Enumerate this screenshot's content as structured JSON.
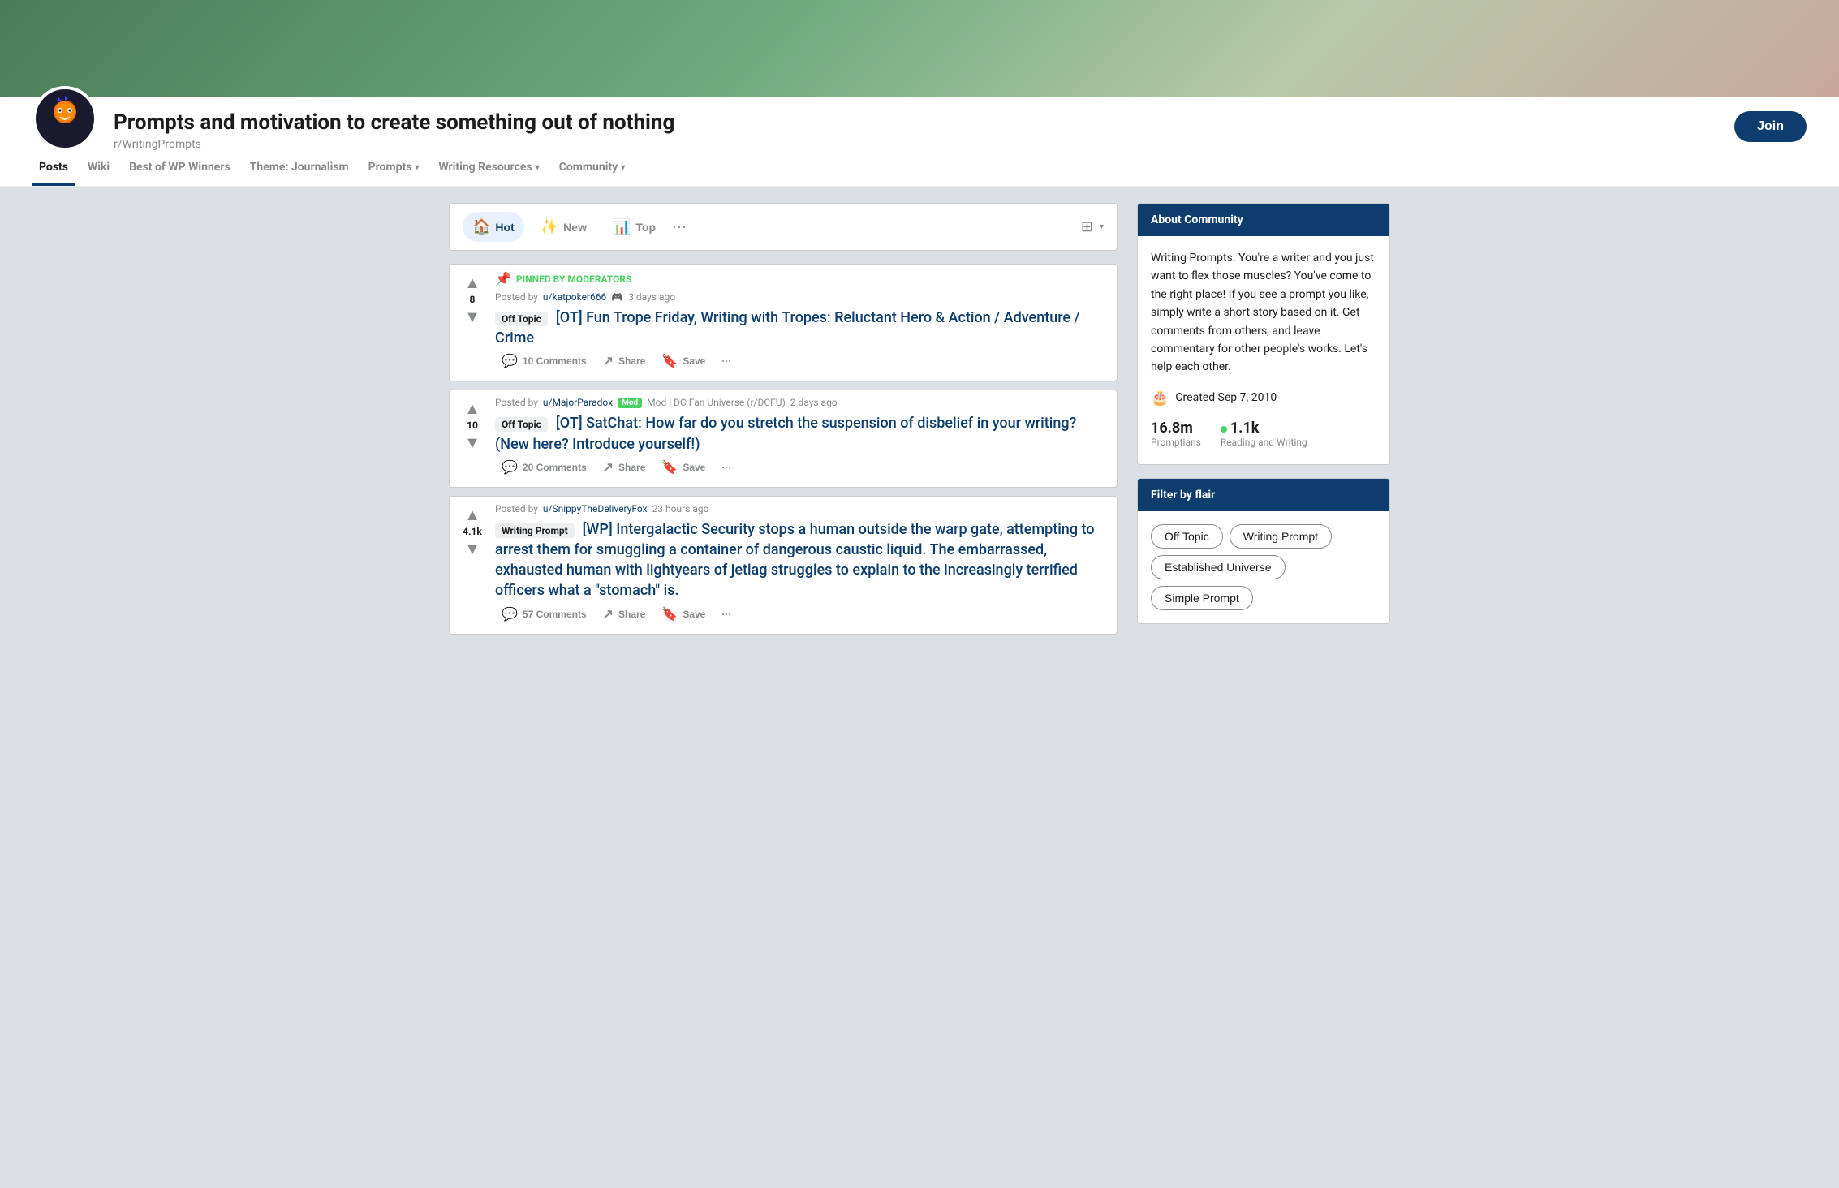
{
  "banner": {
    "alt": "subreddit banner"
  },
  "header": {
    "title": "Prompts and motivation to create something out of nothing",
    "subreddit_name": "r/WritingPrompts",
    "join_label": "Join"
  },
  "nav": {
    "tabs": [
      {
        "id": "posts",
        "label": "Posts",
        "active": true,
        "has_dropdown": false
      },
      {
        "id": "wiki",
        "label": "Wiki",
        "active": false,
        "has_dropdown": false
      },
      {
        "id": "best-of-wp",
        "label": "Best of WP Winners",
        "active": false,
        "has_dropdown": false
      },
      {
        "id": "theme",
        "label": "Theme: Journalism",
        "active": false,
        "has_dropdown": false
      },
      {
        "id": "prompts",
        "label": "Prompts",
        "active": false,
        "has_dropdown": true
      },
      {
        "id": "writing-resources",
        "label": "Writing Resources",
        "active": false,
        "has_dropdown": true
      },
      {
        "id": "community",
        "label": "Community",
        "active": false,
        "has_dropdown": true
      }
    ]
  },
  "sort_bar": {
    "options": [
      {
        "id": "hot",
        "label": "Hot",
        "icon": "🏠",
        "active": true
      },
      {
        "id": "new",
        "label": "New",
        "icon": "✨",
        "active": false
      },
      {
        "id": "top",
        "label": "Top",
        "icon": "📊",
        "active": false
      }
    ],
    "more_label": "···",
    "view_icon": "⊞"
  },
  "posts": [
    {
      "id": "post-1",
      "pinned": true,
      "pinned_label": "PINNED BY MODERATORS",
      "author": "u/katpoker666",
      "author_icon": "🎮",
      "timestamp": "3 days ago",
      "flair": "Off Topic",
      "title": "[OT] Fun Trope Friday, Writing with Tropes: Reluctant Hero & Action / Adventure / Crime",
      "vote_count": "8",
      "comments_count": "10 Comments",
      "share_label": "Share",
      "save_label": "Save",
      "more_label": "···"
    },
    {
      "id": "post-2",
      "pinned": false,
      "author": "u/MajorParadox",
      "author_mod": true,
      "mod_label": "Mod | DC Fan Universe (r/DCFU)",
      "timestamp": "2 days ago",
      "flair": "Off Topic",
      "title": "[OT] SatChat: How far do you stretch the suspension of disbelief in your writing? (New here? Introduce yourself!)",
      "vote_count": "10",
      "comments_count": "20 Comments",
      "share_label": "Share",
      "save_label": "Save",
      "more_label": "···"
    },
    {
      "id": "post-3",
      "pinned": false,
      "author": "u/SnippyTheDeliveryFox",
      "timestamp": "23 hours ago",
      "flair": "Writing Prompt",
      "title": "[WP] Intergalactic Security stops a human outside the warp gate, attempting to arrest them for smuggling a container of dangerous caustic liquid. The embarrassed, exhausted human with lightyears of jetlag struggles to explain to the increasingly terrified officers what a \"stomach\" is.",
      "vote_count": "4.1k",
      "comments_count": "57 Comments",
      "share_label": "Share",
      "save_label": "Save",
      "more_label": "···"
    }
  ],
  "sidebar": {
    "about": {
      "header": "About Community",
      "description": "Writing Prompts. You're a writer and you just want to flex those muscles? You've come to the right place! If you see a prompt you like, simply write a short story based on it. Get comments from others, and leave commentary for other people's works. Let's help each other.",
      "created_label": "Created Sep 7, 2010",
      "members_count": "16.8m",
      "members_label": "Promptians",
      "online_count": "1.1k",
      "online_label": "Reading and Writing"
    },
    "filter": {
      "header": "Filter by flair",
      "flairs": [
        {
          "id": "off-topic",
          "label": "Off Topic"
        },
        {
          "id": "writing-prompt",
          "label": "Writing Prompt"
        },
        {
          "id": "established-universe",
          "label": "Established Universe"
        },
        {
          "id": "simple-prompt",
          "label": "Simple Prompt"
        }
      ]
    }
  }
}
